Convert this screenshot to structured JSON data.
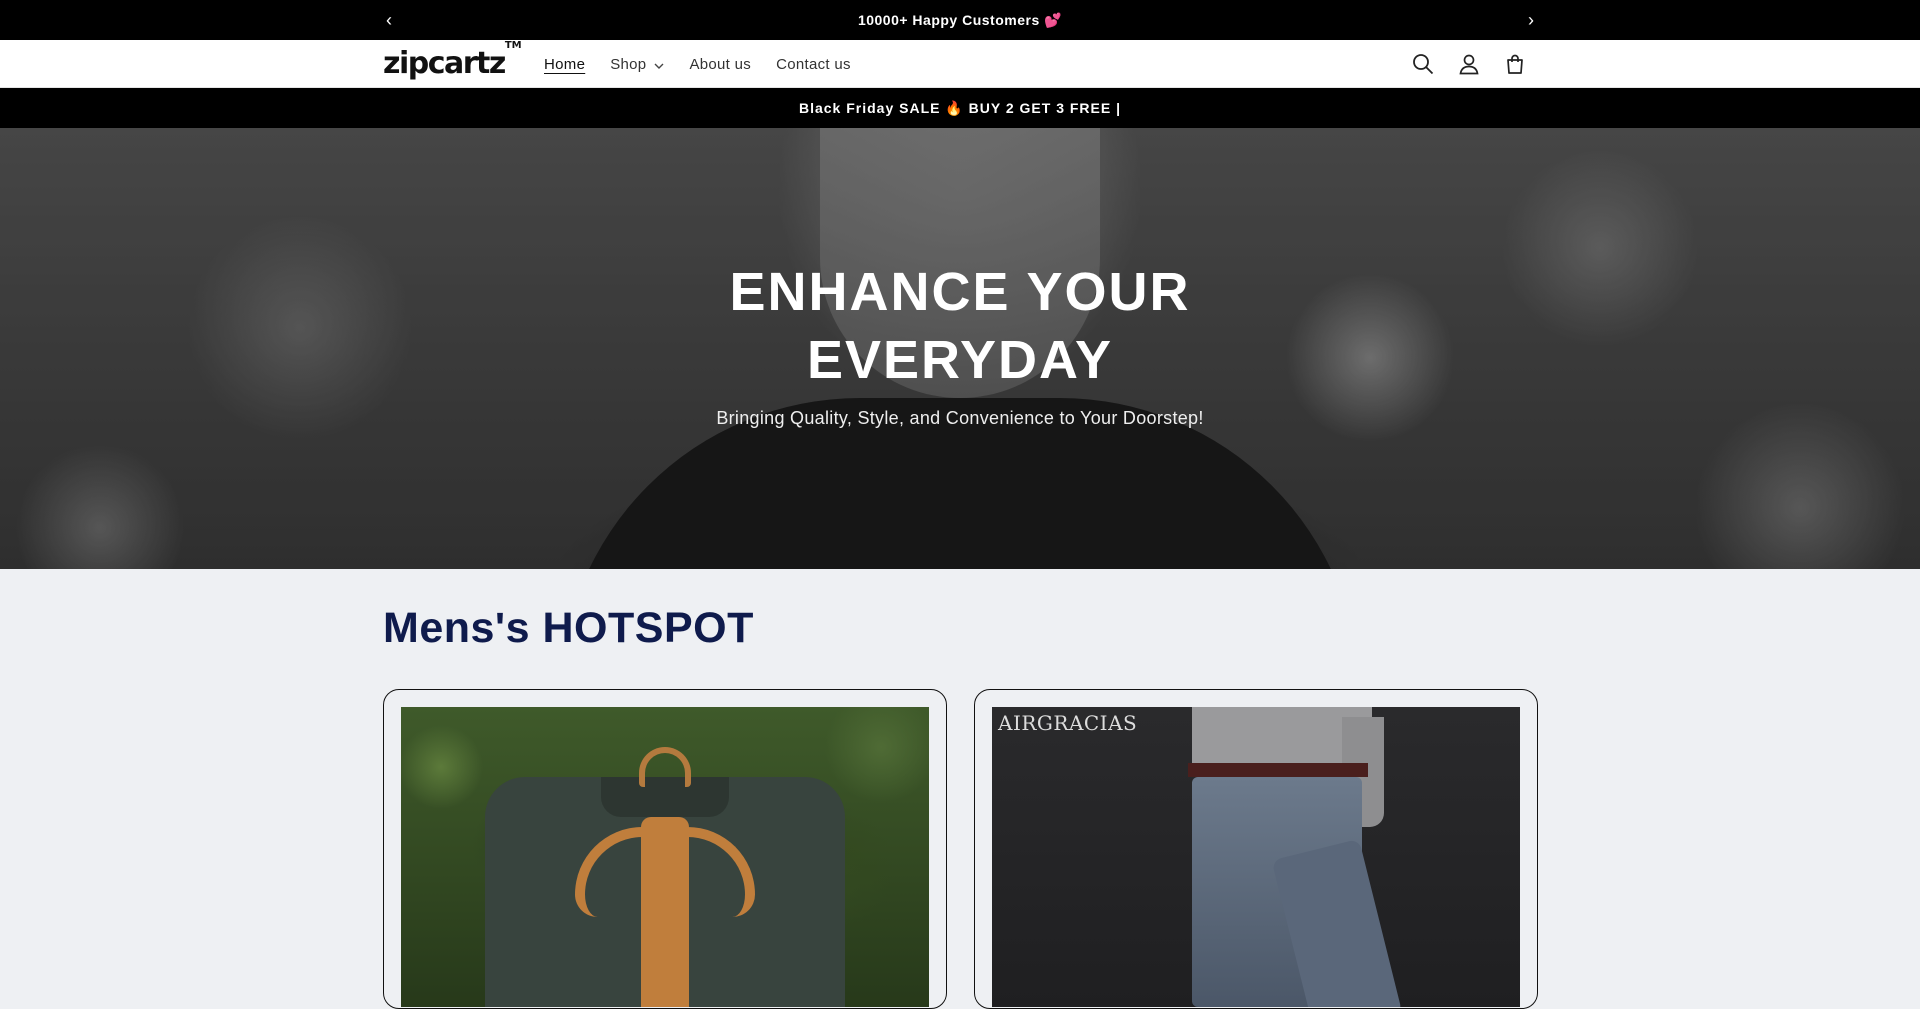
{
  "announcement": {
    "message": "10000+ Happy Customers 💕",
    "prev_icon": "chevron-left-icon",
    "next_icon": "chevron-right-icon"
  },
  "header": {
    "logo": "zipcartz",
    "logo_mark": "TM",
    "nav": [
      {
        "label": "Home",
        "active": true
      },
      {
        "label": "Shop",
        "has_dropdown": true
      },
      {
        "label": "About us"
      },
      {
        "label": "Contact us"
      }
    ],
    "icons": [
      "search-icon",
      "account-icon",
      "cart-icon"
    ]
  },
  "promo": {
    "message": "Black Friday SALE 🔥 BUY 2 GET 3 FREE |"
  },
  "hero": {
    "title_line1": "ENHANCE YOUR",
    "title_line2": "EVERYDAY",
    "subtitle": "Bringing Quality, Style, and Convenience to Your Doorstep!"
  },
  "section": {
    "title": "Mens's HOTSPOT",
    "cards": [
      {
        "image": "shirt-with-tree-print"
      },
      {
        "image": "jeans-model",
        "brand_text": "AIRGRACIAS"
      }
    ]
  },
  "colors": {
    "announcement_bg": "#000000",
    "section_title": "#0f1b4c",
    "page_bg": "#eef0f3"
  }
}
